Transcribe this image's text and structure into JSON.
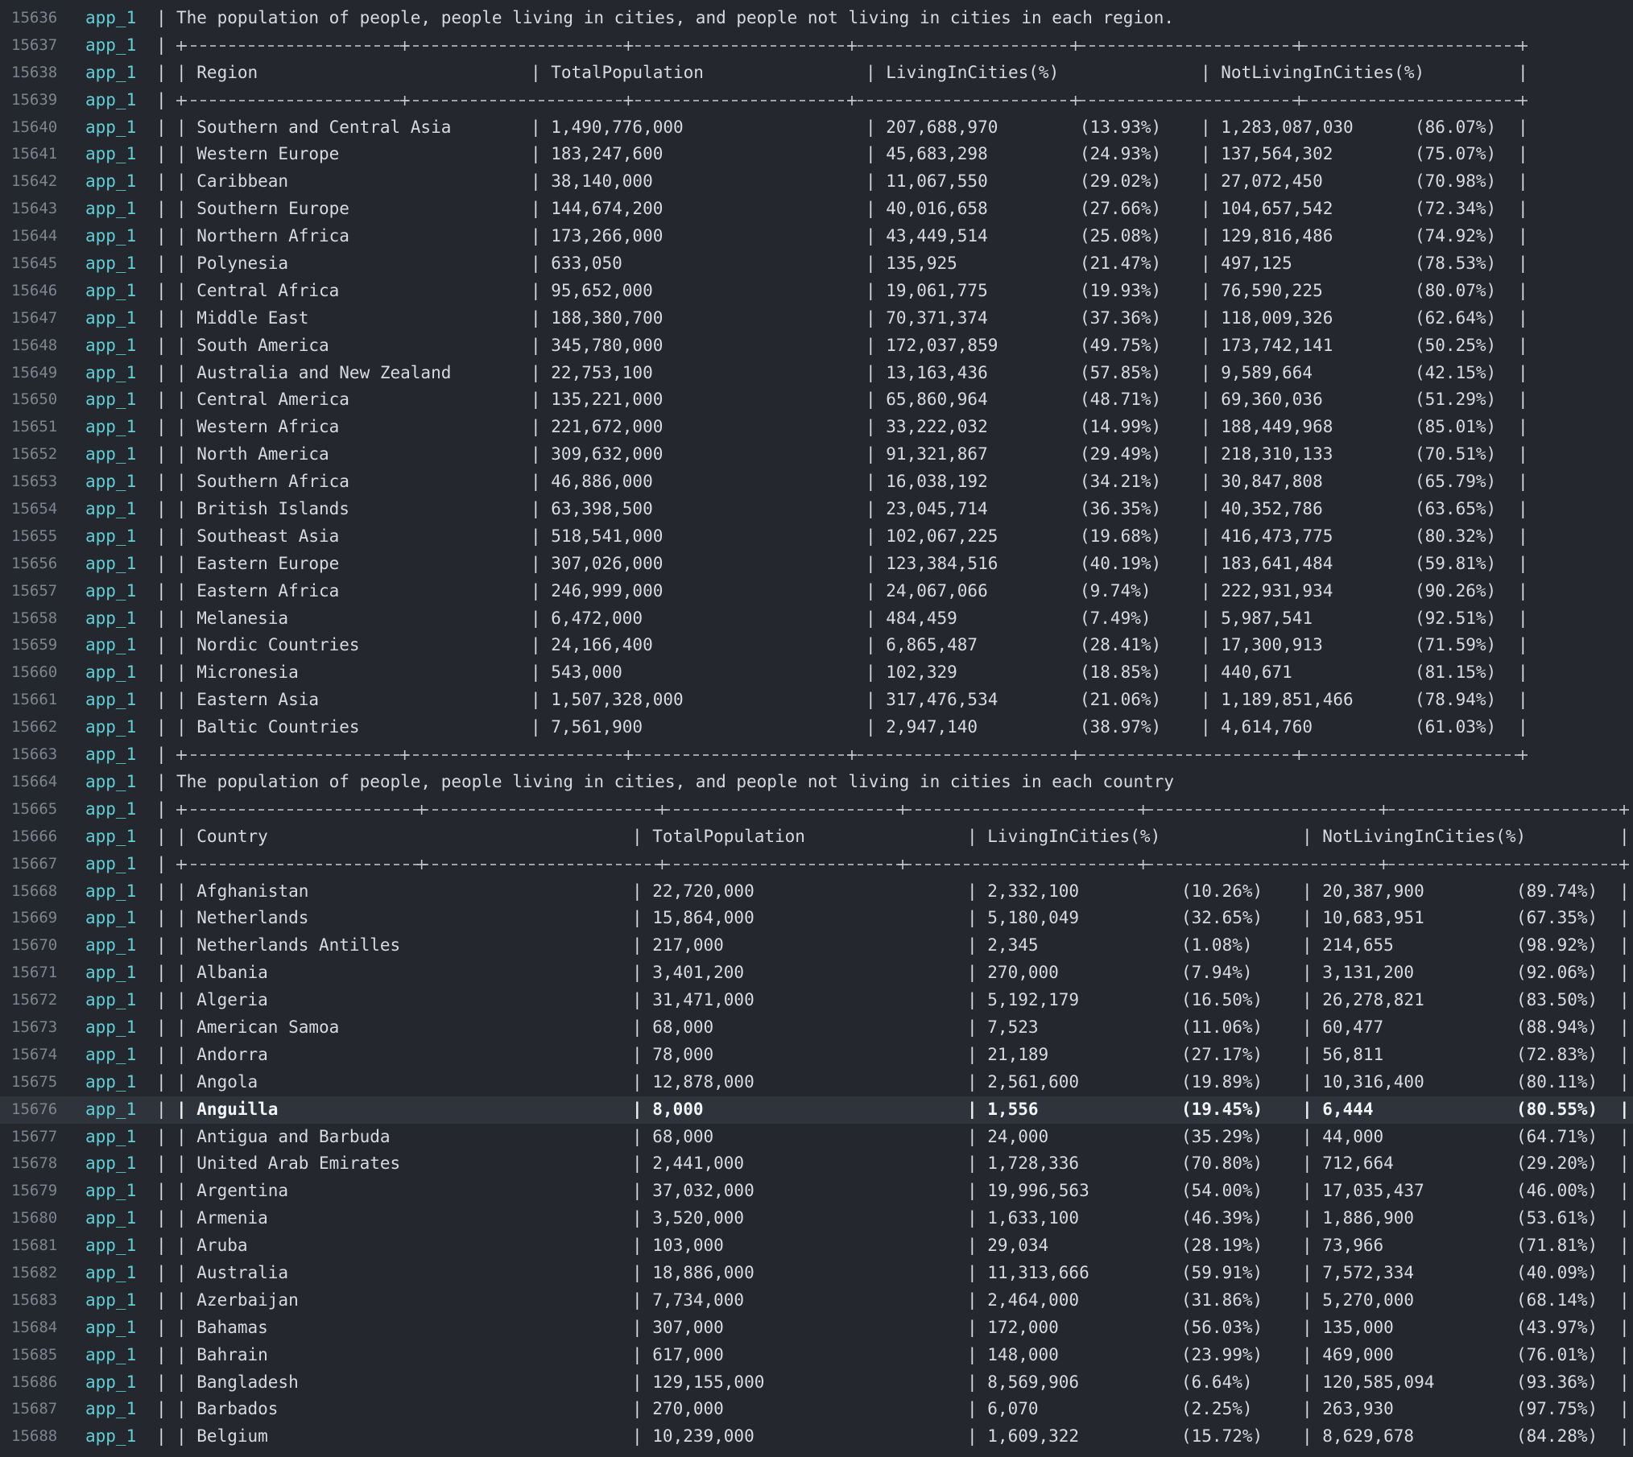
{
  "service_name": "app_1",
  "region_section": {
    "title": "The population of people, people living in cities, and people not living in cities in each region.",
    "headers": [
      "Region",
      "TotalPopulation",
      "LivingInCities(%)",
      "NotLivingInCities(%)"
    ],
    "rows": [
      [
        "Southern and Central Asia",
        "1,490,776,000",
        "207,688,970",
        "(13.93%)",
        "1,283,087,030",
        "(86.07%)"
      ],
      [
        "Western Europe",
        "183,247,600",
        "45,683,298",
        "(24.93%)",
        "137,564,302",
        "(75.07%)"
      ],
      [
        "Caribbean",
        "38,140,000",
        "11,067,550",
        "(29.02%)",
        "27,072,450",
        "(70.98%)"
      ],
      [
        "Southern Europe",
        "144,674,200",
        "40,016,658",
        "(27.66%)",
        "104,657,542",
        "(72.34%)"
      ],
      [
        "Northern Africa",
        "173,266,000",
        "43,449,514",
        "(25.08%)",
        "129,816,486",
        "(74.92%)"
      ],
      [
        "Polynesia",
        "633,050",
        "135,925",
        "(21.47%)",
        "497,125",
        "(78.53%)"
      ],
      [
        "Central Africa",
        "95,652,000",
        "19,061,775",
        "(19.93%)",
        "76,590,225",
        "(80.07%)"
      ],
      [
        "Middle East",
        "188,380,700",
        "70,371,374",
        "(37.36%)",
        "118,009,326",
        "(62.64%)"
      ],
      [
        "South America",
        "345,780,000",
        "172,037,859",
        "(49.75%)",
        "173,742,141",
        "(50.25%)"
      ],
      [
        "Australia and New Zealand",
        "22,753,100",
        "13,163,436",
        "(57.85%)",
        "9,589,664",
        "(42.15%)"
      ],
      [
        "Central America",
        "135,221,000",
        "65,860,964",
        "(48.71%)",
        "69,360,036",
        "(51.29%)"
      ],
      [
        "Western Africa",
        "221,672,000",
        "33,222,032",
        "(14.99%)",
        "188,449,968",
        "(85.01%)"
      ],
      [
        "North America",
        "309,632,000",
        "91,321,867",
        "(29.49%)",
        "218,310,133",
        "(70.51%)"
      ],
      [
        "Southern Africa",
        "46,886,000",
        "16,038,192",
        "(34.21%)",
        "30,847,808",
        "(65.79%)"
      ],
      [
        "British Islands",
        "63,398,500",
        "23,045,714",
        "(36.35%)",
        "40,352,786",
        "(63.65%)"
      ],
      [
        "Southeast Asia",
        "518,541,000",
        "102,067,225",
        "(19.68%)",
        "416,473,775",
        "(80.32%)"
      ],
      [
        "Eastern Europe",
        "307,026,000",
        "123,384,516",
        "(40.19%)",
        "183,641,484",
        "(59.81%)"
      ],
      [
        "Eastern Africa",
        "246,999,000",
        "24,067,066",
        "(9.74%)",
        "222,931,934",
        "(90.26%)"
      ],
      [
        "Melanesia",
        "6,472,000",
        "484,459",
        "(7.49%)",
        "5,987,541",
        "(92.51%)"
      ],
      [
        "Nordic Countries",
        "24,166,400",
        "6,865,487",
        "(28.41%)",
        "17,300,913",
        "(71.59%)"
      ],
      [
        "Micronesia",
        "543,000",
        "102,329",
        "(18.85%)",
        "440,671",
        "(81.15%)"
      ],
      [
        "Eastern Asia",
        "1,507,328,000",
        "317,476,534",
        "(21.06%)",
        "1,189,851,466",
        "(78.94%)"
      ],
      [
        "Baltic Countries",
        "7,561,900",
        "2,947,140",
        "(38.97%)",
        "4,614,760",
        "(61.03%)"
      ]
    ]
  },
  "country_section": {
    "title": "The population of people, people living in cities, and people not living in cities in each country",
    "headers": [
      "Country",
      "TotalPopulation",
      "LivingInCities(%)",
      "NotLivingInCities(%)"
    ],
    "rows": [
      [
        "Afghanistan",
        "22,720,000",
        "2,332,100",
        "(10.26%)",
        "20,387,900",
        "(89.74%)"
      ],
      [
        "Netherlands",
        "15,864,000",
        "5,180,049",
        "(32.65%)",
        "10,683,951",
        "(67.35%)"
      ],
      [
        "Netherlands Antilles",
        "217,000",
        "2,345",
        "(1.08%)",
        "214,655",
        "(98.92%)"
      ],
      [
        "Albania",
        "3,401,200",
        "270,000",
        "(7.94%)",
        "3,131,200",
        "(92.06%)"
      ],
      [
        "Algeria",
        "31,471,000",
        "5,192,179",
        "(16.50%)",
        "26,278,821",
        "(83.50%)"
      ],
      [
        "American Samoa",
        "68,000",
        "7,523",
        "(11.06%)",
        "60,477",
        "(88.94%)"
      ],
      [
        "Andorra",
        "78,000",
        "21,189",
        "(27.17%)",
        "56,811",
        "(72.83%)"
      ],
      [
        "Angola",
        "12,878,000",
        "2,561,600",
        "(19.89%)",
        "10,316,400",
        "(80.11%)"
      ],
      [
        "Anguilla",
        "8,000",
        "1,556",
        "(19.45%)",
        "6,444",
        "(80.55%)"
      ],
      [
        "Antigua and Barbuda",
        "68,000",
        "24,000",
        "(35.29%)",
        "44,000",
        "(64.71%)"
      ],
      [
        "United Arab Emirates",
        "2,441,000",
        "1,728,336",
        "(70.80%)",
        "712,664",
        "(29.20%)"
      ],
      [
        "Argentina",
        "37,032,000",
        "19,996,563",
        "(54.00%)",
        "17,035,437",
        "(46.00%)"
      ],
      [
        "Armenia",
        "3,520,000",
        "1,633,100",
        "(46.39%)",
        "1,886,900",
        "(53.61%)"
      ],
      [
        "Aruba",
        "103,000",
        "29,034",
        "(28.19%)",
        "73,966",
        "(71.81%)"
      ],
      [
        "Australia",
        "18,886,000",
        "11,313,666",
        "(59.91%)",
        "7,572,334",
        "(40.09%)"
      ],
      [
        "Azerbaijan",
        "7,734,000",
        "2,464,000",
        "(31.86%)",
        "5,270,000",
        "(68.14%)"
      ],
      [
        "Bahamas",
        "307,000",
        "172,000",
        "(56.03%)",
        "135,000",
        "(43.97%)"
      ],
      [
        "Bahrain",
        "617,000",
        "148,000",
        "(23.99%)",
        "469,000",
        "(76.01%)"
      ],
      [
        "Bangladesh",
        "129,155,000",
        "8,569,906",
        "(6.64%)",
        "120,585,094",
        "(93.36%)"
      ],
      [
        "Barbados",
        "270,000",
        "6,070",
        "(2.25%)",
        "263,930",
        "(97.75%)"
      ],
      [
        "Belgium",
        "10,239,000",
        "1,609,322",
        "(15.72%)",
        "8,629,678",
        "(84.28%)"
      ]
    ],
    "highlighted_row_index": 8
  }
}
